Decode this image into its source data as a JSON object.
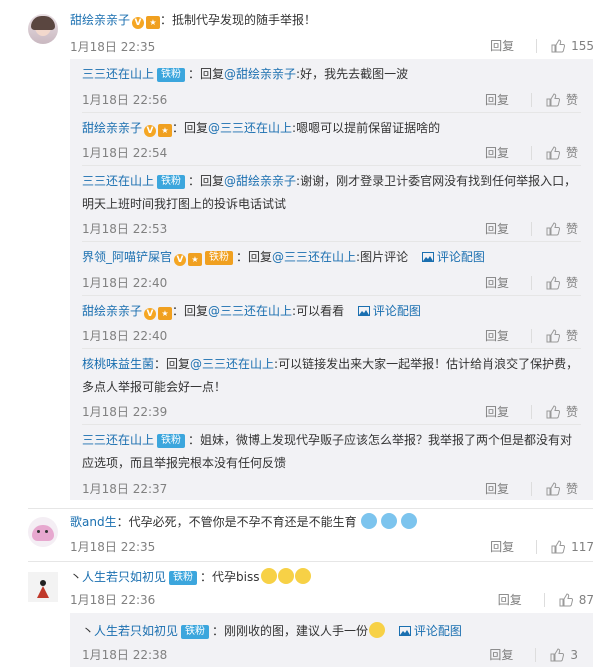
{
  "comments": [
    {
      "user": "甜绘亲亲子",
      "text": "：抵制代孕发现的随手举报！",
      "time": "1月18日 22:35",
      "reply_label": "回复",
      "likes": "155"
    },
    {
      "user": "歌and生",
      "text": "：代孕必死，不管你是不孕不育还是不能生育",
      "time": "1月18日 22:35",
      "reply_label": "回复",
      "likes": "117"
    },
    {
      "user": "人生若只如初见",
      "badge": "铁粉",
      "text": "：代孕biss",
      "time": "1月18日 22:36",
      "reply_label": "回复",
      "likes": "87"
    }
  ],
  "replies_1": [
    {
      "user": "三三还在山上",
      "badge": "铁粉",
      "prefix": "：回复",
      "at": "@甜绘亲亲子",
      "text": ":好，我先去截图一波",
      "time": "1月18日 22:56",
      "reply_label": "回复",
      "like_label": "赞"
    },
    {
      "user": "甜绘亲亲子",
      "prefix": "：回复",
      "at": "@三三还在山上",
      "text": ":嗯嗯可以提前保留证据啥的",
      "time": "1月18日 22:54",
      "reply_label": "回复",
      "like_label": "赞"
    },
    {
      "user": "三三还在山上",
      "badge": "铁粉",
      "prefix": "：回复",
      "at": "@甜绘亲亲子",
      "text": ":谢谢，刚才登录卫计委官网没有找到任何举报入口，",
      "text2": "明天上班时间我打图上的投诉电话试试",
      "time": "1月18日 22:53",
      "reply_label": "回复",
      "like_label": "赞"
    },
    {
      "user": "界领_阿喵铲屎官",
      "badge": "铁粉",
      "prefix": "：回复",
      "at": "@三三还在山上",
      "text": ":图片评论",
      "pic_label": "评论配图",
      "time": "1月18日 22:40",
      "reply_label": "回复",
      "like_label": "赞"
    },
    {
      "user": "甜绘亲亲子",
      "prefix": "：回复",
      "at": "@三三还在山上",
      "text": ":可以看看",
      "pic_label": "评论配图",
      "time": "1月18日 22:40",
      "reply_label": "回复",
      "like_label": "赞"
    },
    {
      "user": "核桃味益生菌",
      "prefix": "：回复",
      "at": "@三三还在山上",
      "text": ":可以链接发出来大家一起举报！估计给肖浪交了保护费，",
      "text2": "多点人举报可能会好一点！",
      "time": "1月18日 22:39",
      "reply_label": "回复",
      "like_label": "赞"
    },
    {
      "user": "三三还在山上",
      "badge": "铁粉",
      "prefix": "",
      "at": "",
      "text": "：姐妹，微博上发现代孕贩子应该怎么举报？我举报了两个但是都没有对",
      "text2": "应选项，而且举报完根本没有任何反馈",
      "time": "1月18日 22:37",
      "reply_label": "回复",
      "like_label": "赞"
    }
  ],
  "replies_3": [
    {
      "user": "人生若只如初见",
      "badge": "铁粉",
      "text": "：刚刚收的图，建议人手一份",
      "pic_label": "评论配图",
      "time": "1月18日 22:38",
      "reply_label": "回复",
      "likes": "3"
    }
  ],
  "colors": {
    "link": "#1a6fb0",
    "badge": "#3ca6dd",
    "reply_bg": "#f2f2f5"
  }
}
